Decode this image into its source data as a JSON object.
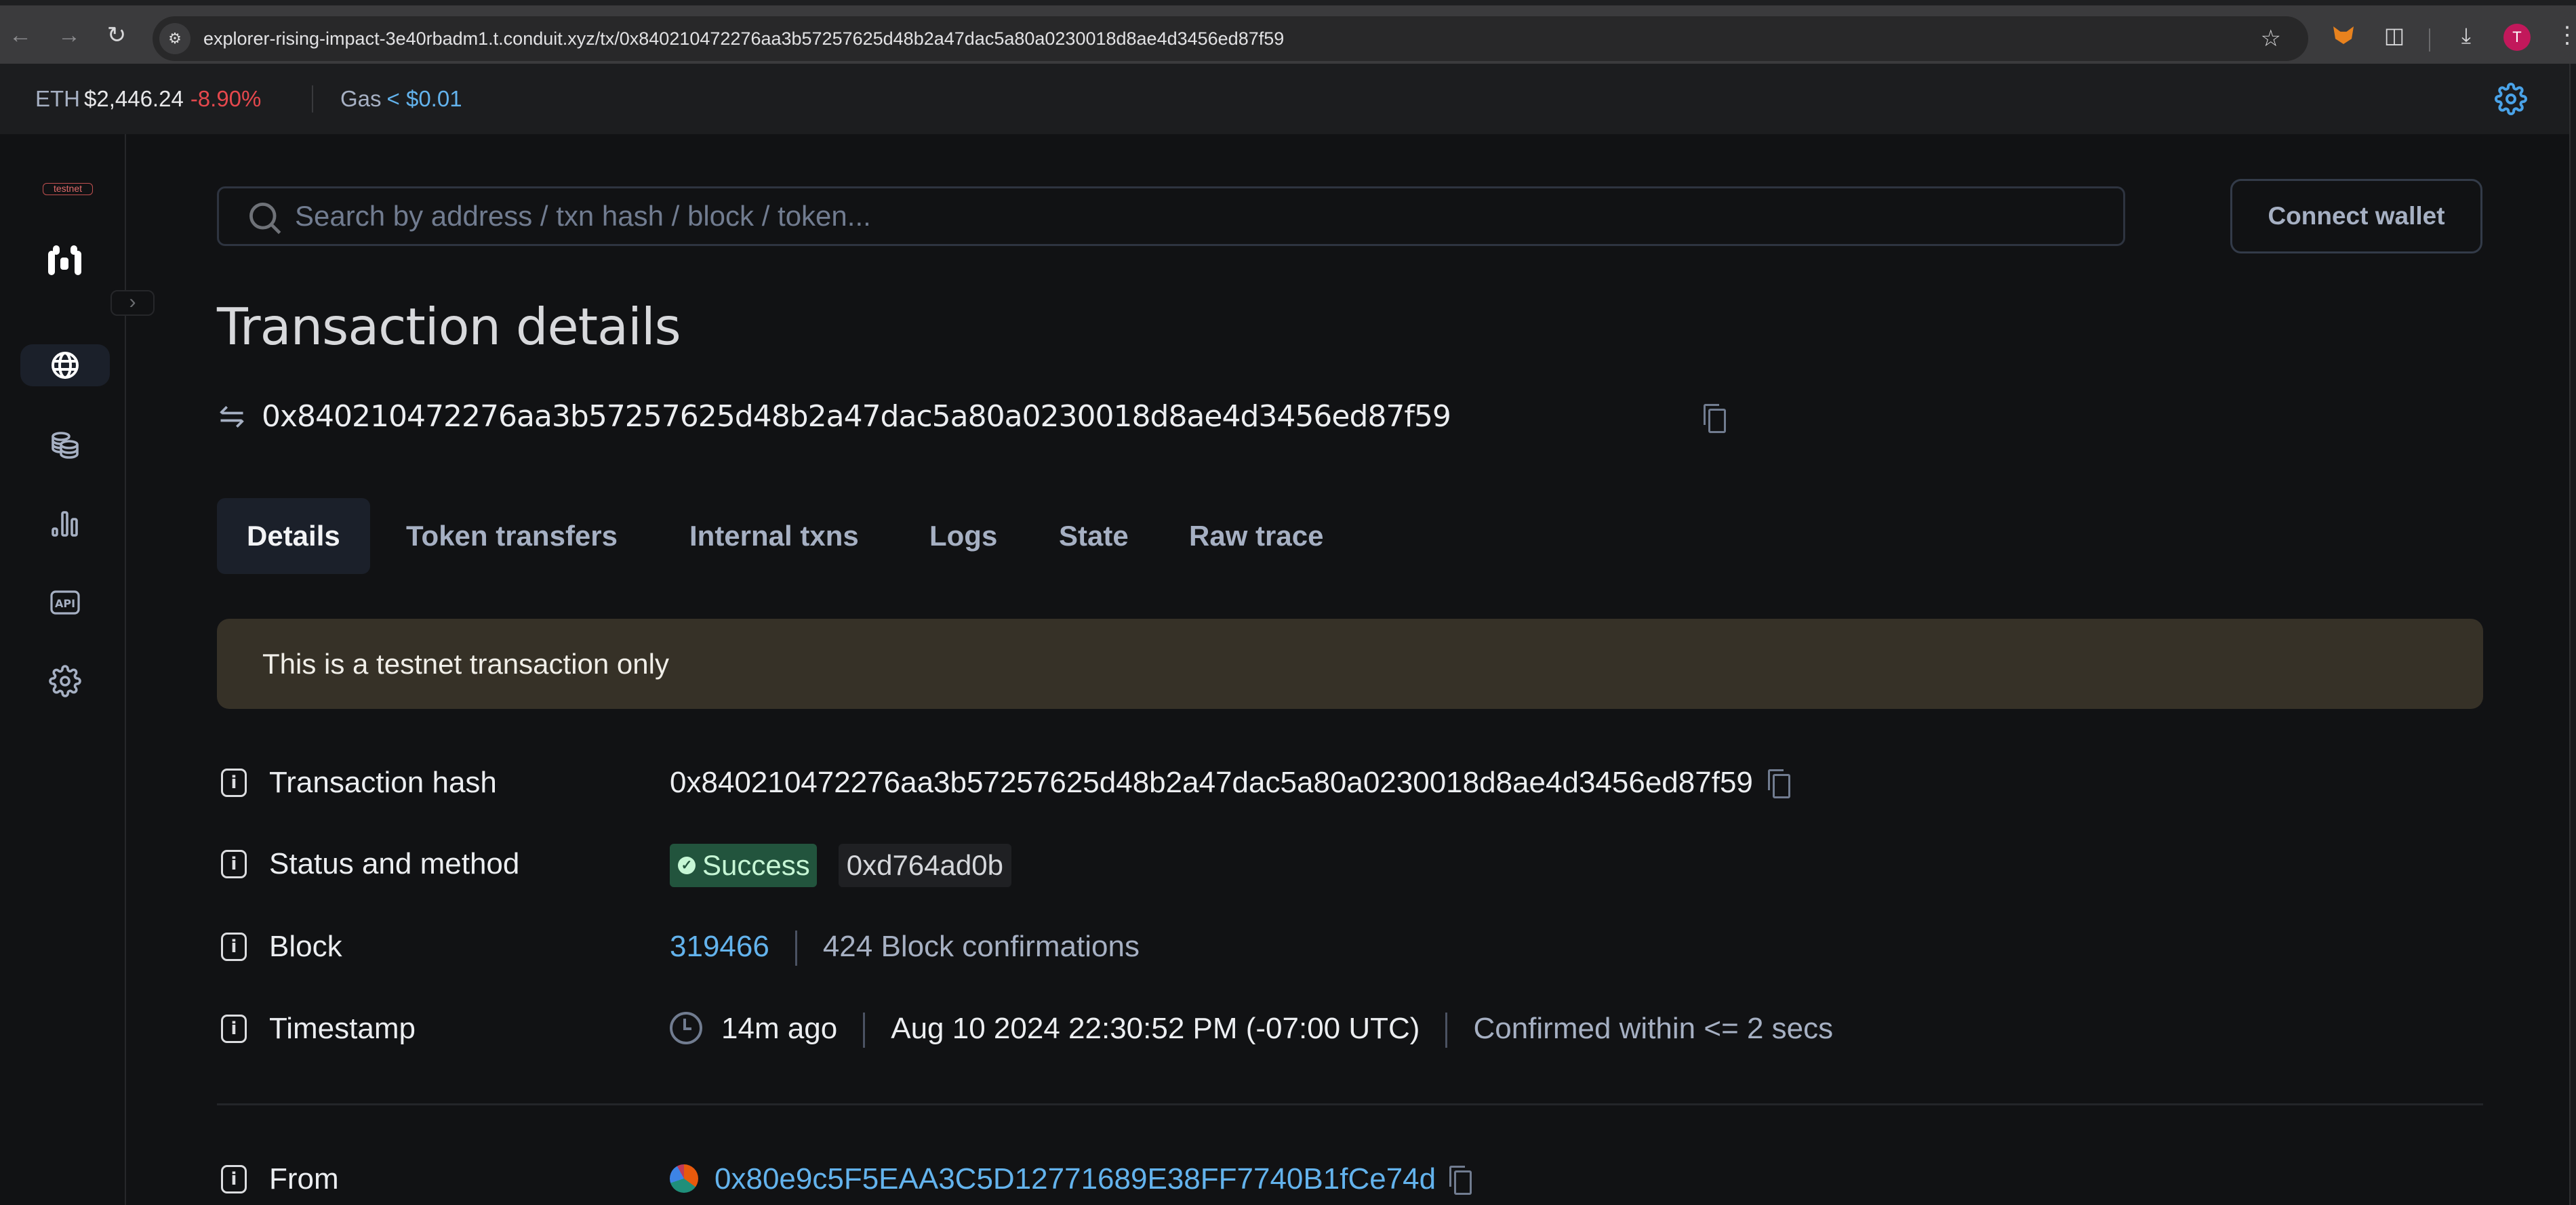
{
  "browser": {
    "url": "explorer-rising-impact-3e40rbadm1.t.conduit.xyz/tx/0x840210472276aa3b57257625d48b2a47dac5a80a0230018d8ae4d3456ed87f59",
    "profile_initial": "T",
    "icons": [
      "back-icon",
      "forward-icon",
      "reload-icon",
      "site-info-icon",
      "bookmark-star-icon",
      "metamask-fox-icon",
      "extensions-puzzle-icon",
      "download-icon",
      "profile-avatar",
      "more-menu-icon"
    ]
  },
  "infobar": {
    "eth_label": "ETH",
    "eth_price": "$2,446.24",
    "eth_change": "-8.90%",
    "gas_label": "Gas",
    "gas_value": "< $0.01",
    "colors": {
      "negative": "#e5484d",
      "link": "#63b3ed"
    }
  },
  "sidebar": {
    "network_badge": "testnet",
    "items": [
      {
        "icon": "globe-icon",
        "label": "Blockchain",
        "active": true
      },
      {
        "icon": "coins-icon",
        "label": "Tokens",
        "active": false
      },
      {
        "icon": "bar-chart-icon",
        "label": "Charts & stats",
        "active": false
      },
      {
        "icon": "api-icon",
        "label": "API",
        "active": false
      },
      {
        "icon": "gear-icon",
        "label": "Settings",
        "active": false
      }
    ]
  },
  "search": {
    "placeholder": "Search by address / txn hash / block / token...",
    "value": ""
  },
  "header": {
    "connect_wallet": "Connect wallet",
    "title": "Transaction details",
    "tx_hash": "0x840210472276aa3b57257625d48b2a47dac5a80a0230018d8ae4d3456ed87f59"
  },
  "tabs": [
    {
      "label": "Details",
      "active": true
    },
    {
      "label": "Token transfers",
      "active": false
    },
    {
      "label": "Internal txns",
      "active": false
    },
    {
      "label": "Logs",
      "active": false
    },
    {
      "label": "State",
      "active": false
    },
    {
      "label": "Raw trace",
      "active": false
    }
  ],
  "banner": {
    "text": "This is a testnet transaction only"
  },
  "details": {
    "tx_hash": {
      "label": "Transaction hash",
      "value": "0x840210472276aa3b57257625d48b2a47dac5a80a0230018d8ae4d3456ed87f59"
    },
    "status": {
      "label": "Status and method",
      "status": "Success",
      "method": "0xd764ad0b",
      "status_color": "#22543d"
    },
    "block": {
      "label": "Block",
      "number": "319466",
      "confirmations": "424 Block confirmations"
    },
    "timestamp": {
      "label": "Timestamp",
      "relative": "14m ago",
      "absolute": "Aug 10 2024 22:30:52 PM (-07:00 UTC)",
      "confirmed": "Confirmed within <= 2 secs"
    },
    "from": {
      "label": "From",
      "address": "0x80e9c5F5EAA3C5D12771689E38FF7740B1fCe74d"
    }
  }
}
